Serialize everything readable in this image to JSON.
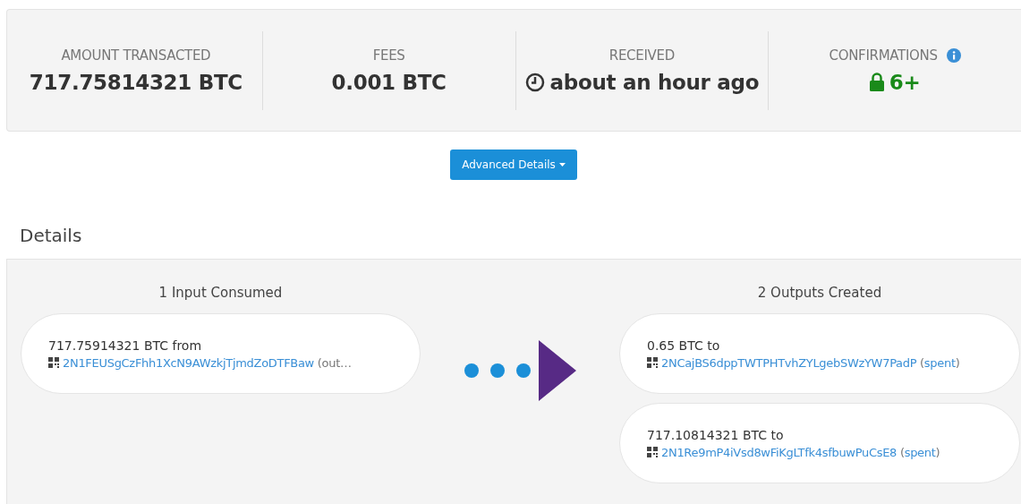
{
  "summary": [
    {
      "kind": "plain",
      "label": "AMOUNT TRANSACTED",
      "value": "717.75814321 BTC"
    },
    {
      "kind": "plain",
      "label": "FEES",
      "value": "0.001 BTC"
    },
    {
      "kind": "clock",
      "label": "RECEIVED",
      "value": "about an hour ago"
    },
    {
      "kind": "lock",
      "label": "CONFIRMATIONS",
      "value": "6+",
      "info": true
    }
  ],
  "advanced_button": {
    "label": "Advanced Details"
  },
  "details": {
    "title": "Details",
    "inputs": {
      "heading": "1 Input Consumed",
      "items": [
        {
          "amount": "717.75914321 BTC",
          "direction": "from",
          "address": "2N1FEUSgCzFhh1XcN9AWzkjTjmdZoDTFBaw",
          "note": [
            {
              "text": " (out…",
              "link": false
            }
          ]
        }
      ]
    },
    "outputs": {
      "heading": "2 Outputs Created",
      "items": [
        {
          "amount": "0.65 BTC",
          "direction": "to",
          "address": "2NCajBS6dppTWTPHTvhZYLgebSWzYW7PadP",
          "note": [
            {
              "text": " (",
              "link": false
            },
            {
              "text": "spent",
              "link": true
            },
            {
              "text": ")",
              "link": false
            }
          ]
        },
        {
          "amount": "717.10814321 BTC",
          "direction": "to",
          "address": "2N1Re9mP4iVsd8wFiKgLTfk4sfbuwPuCsE8",
          "note": [
            {
              "text": " (",
              "link": false
            },
            {
              "text": "spent",
              "link": true
            },
            {
              "text": ")",
              "link": false
            }
          ]
        }
      ]
    }
  }
}
